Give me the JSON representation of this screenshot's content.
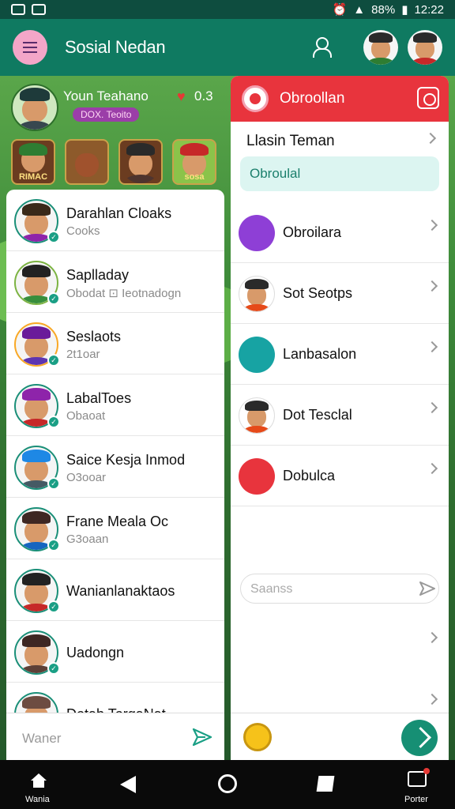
{
  "status_bar": {
    "battery": "88%",
    "time": "12:22"
  },
  "app_bar": {
    "title": "Sosial Nedan"
  },
  "game": {
    "player_name": "Youn Teahano",
    "player_score": "0.3",
    "player_badge": "DOX. Teoito",
    "tiles": [
      "RIMAC",
      "",
      "",
      "sosa"
    ]
  },
  "chats": [
    {
      "name": "Darahlan Cloaks",
      "sub": "Cooks",
      "ring": "#1a8f78",
      "shirt": "#8e24aa",
      "hat": "#3a2a1a"
    },
    {
      "name": "Saplladay",
      "sub": "Obodat  ⊡  Ieotnadogn",
      "ring": "#7cb342",
      "shirt": "#388e3c",
      "hat": "#222222"
    },
    {
      "name": "Seslaots",
      "sub": "2t1oar",
      "ring": "#f9a825",
      "shirt": "#5e35b1",
      "hat": "#6a1b9a"
    },
    {
      "name": "LabalToes",
      "sub": "Obaoat",
      "ring": "#1a8f78",
      "shirt": "#c62828",
      "hat": "#8e24aa"
    },
    {
      "name": "Saice Kesja Inmod",
      "sub": "O3ooar",
      "ring": "#1a8f78",
      "shirt": "#455a64",
      "hat": "#1e88e5"
    },
    {
      "name": "Frane Meala Oc",
      "sub": "G3oaan",
      "ring": "#1a8f78",
      "shirt": "#1565c0",
      "hat": "#3e2723"
    },
    {
      "name": "Wanianlanaktaos",
      "sub": "",
      "ring": "#1a8f78",
      "shirt": "#c62828",
      "hat": "#222222"
    },
    {
      "name": "Uadongn",
      "sub": "",
      "ring": "#1a8f78",
      "shirt": "#5d4037",
      "hat": "#3e2723"
    },
    {
      "name": "Dotab TorgaNat",
      "sub": "",
      "ring": "#1a8f78",
      "shirt": "#2e7d32",
      "hat": "#6d4c41"
    }
  ],
  "compose": {
    "placeholder": "Waner"
  },
  "right_panel": {
    "title": "Obroollan",
    "section": "Llasin Teman",
    "search": "Obroulal",
    "rows": [
      {
        "name": "Obroilara",
        "color": "#8e3fd6"
      },
      {
        "name": "Sot Seotps",
        "color": "#ffffff"
      },
      {
        "name": "Lanbasalon",
        "color": "#17a3a3"
      },
      {
        "name": "Dot Tesclal",
        "color": "#ffffff"
      },
      {
        "name": "Dobulca",
        "color": "#e8343d"
      }
    ],
    "input": "Saanss"
  },
  "nav": {
    "home": "Wania",
    "portal": "Porter"
  }
}
